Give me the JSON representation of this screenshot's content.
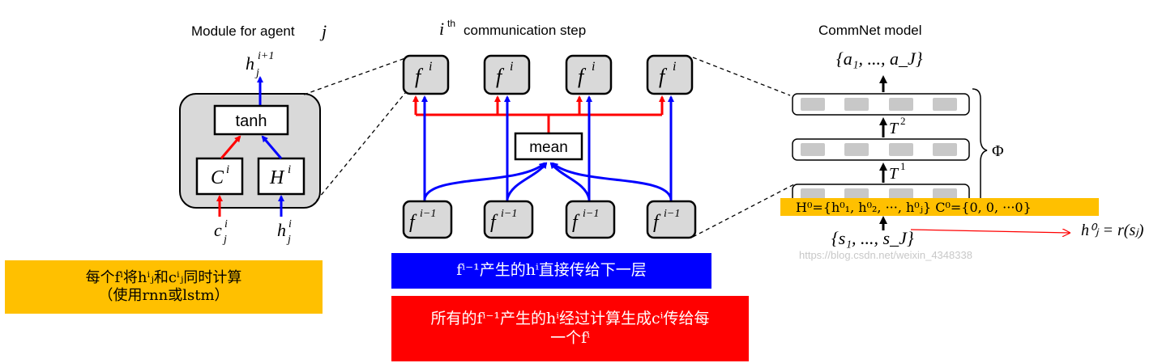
{
  "module": {
    "title": "Module for agent",
    "title_var": "j",
    "output": "h",
    "output_sub": "j",
    "output_sup": "i+1",
    "tanh": "tanh",
    "c_box": "C",
    "c_box_sup": "i",
    "h_box": "H",
    "h_box_sup": "i",
    "in_c": "c",
    "in_c_sub": "j",
    "in_c_sup": "i",
    "in_h": "h",
    "in_h_sub": "j",
    "in_h_sup": "i"
  },
  "comm_step": {
    "title_var": "i",
    "title_sup": "th",
    "title": "communication step",
    "f_top": "f",
    "f_top_sup": "i",
    "f_bottom": "f",
    "f_bottom_sup": "i−1",
    "mean": "mean"
  },
  "commnet": {
    "title": "CommNet model",
    "output_set": "{a₁, ..., a_J}",
    "t2": "T",
    "t2_sup": "2",
    "t1": "T",
    "t1_sup": "1",
    "phi": "Φ",
    "input_set": "{s₁, ..., s_J}",
    "h0_label": "H⁰={h⁰₁, h⁰₂, ···, h⁰ⱼ}  C⁰={0, 0, ···0}",
    "h0_eq": "h⁰ⱼ = r(sⱼ)",
    "watermark": "https://blog.csdn.net/weixin_4348338"
  },
  "notes": {
    "yellow_line1": "每个fⁱ将hⁱⱼ和cⁱⱼ同时计算",
    "yellow_line2": "（使用rnn或lstm）",
    "blue": "fⁱ⁻¹产生的hⁱ直接传给下一层",
    "red_line1": "所有的fⁱ⁻¹产生的hⁱ经过计算生成cⁱ传给每",
    "red_line2": "一个fⁱ"
  },
  "colors": {
    "red": "#ff0000",
    "blue": "#0000ff",
    "yellow": "#ffc000",
    "box_fill": "#d9d9d9",
    "note_blue": "#0000ff",
    "note_red": "#ff0000",
    "note_yellow": "#ffc000"
  }
}
